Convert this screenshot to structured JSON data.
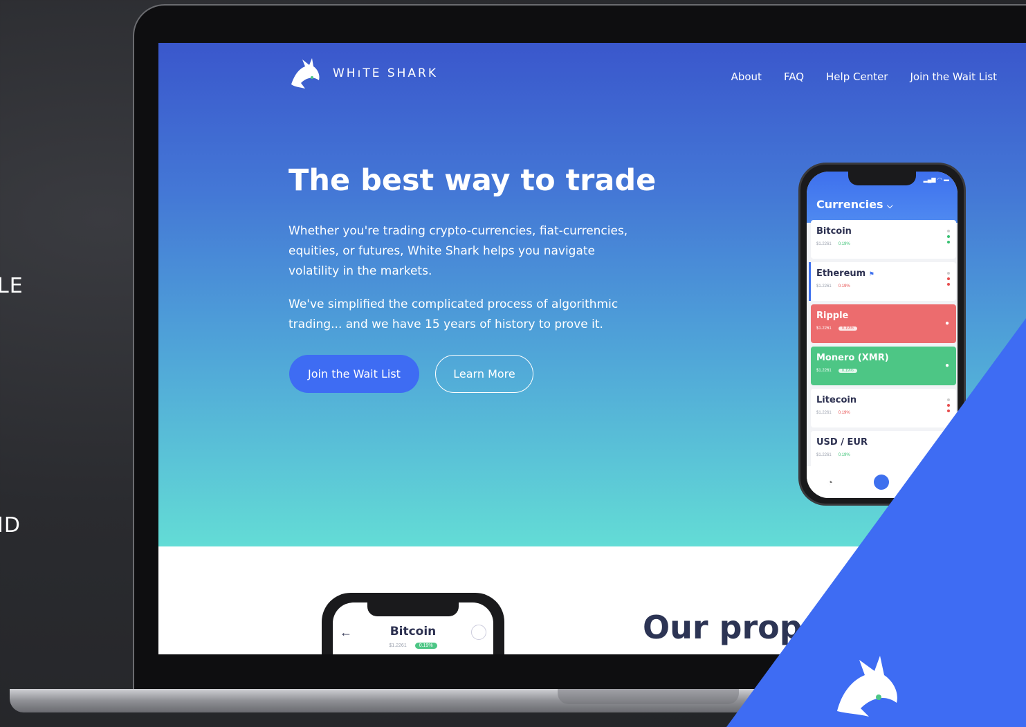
{
  "side_labels": [
    "LE",
    "ID"
  ],
  "brand": {
    "name": "WHıTE SHARK"
  },
  "nav": [
    "About",
    "FAQ",
    "Help Center",
    "Join the Wait List"
  ],
  "hero": {
    "headline": "The best way to trade",
    "para1": "Whether you're trading crypto-currencies, fiat-currencies, equities, or futures, White Shark helps you navigate volatility in the markets.",
    "para2": "We've simplified the complicated process of algorithmic trading... and we have 15 years of history to prove it.",
    "primary_button": "Join the Wait List",
    "secondary_button": "Learn More"
  },
  "phone": {
    "title": "Currencies",
    "items": [
      {
        "name": "Bitcoin",
        "price": "$1.2261",
        "change": "0.19%",
        "trend": "up"
      },
      {
        "name": "Ethereum",
        "price": "$1.2261",
        "change": "0.19%",
        "trend": "down"
      },
      {
        "name": "Ripple",
        "price": "$1.2261",
        "change": "0.19%",
        "trend": "down"
      },
      {
        "name": "Monero (XMR)",
        "price": "$1.2261",
        "change": "0.19%",
        "trend": "up"
      },
      {
        "name": "Litecoin",
        "price": "$1.2261",
        "change": "0.19%",
        "trend": "down"
      },
      {
        "name": "USD / EUR",
        "price": "$1.2261",
        "change": "0.19%",
        "trend": "up"
      }
    ]
  },
  "phone2": {
    "title": "Bitcoin",
    "price": "$1.2261",
    "change": "0.19%"
  },
  "section2": {
    "title": "Our propri"
  },
  "colors": {
    "accent": "#3e6cf3",
    "green": "#4dc685",
    "red": "#ec6c6e"
  }
}
